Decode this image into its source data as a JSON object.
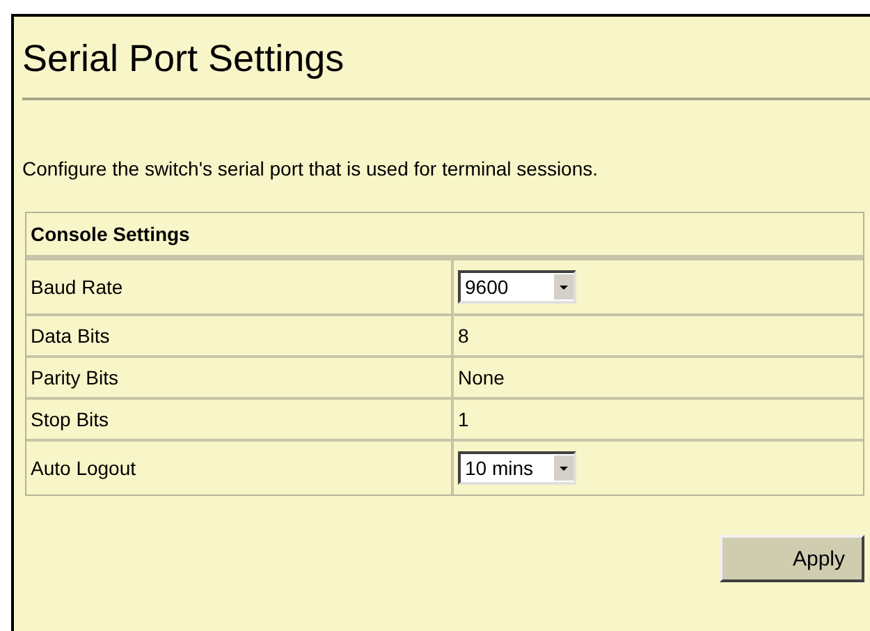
{
  "title": "Serial Port Settings",
  "description": "Configure the switch's serial port that is used for terminal sessions.",
  "table": {
    "heading": "Console Settings",
    "rows": [
      {
        "label": "Baud Rate",
        "kind": "select",
        "value": "9600"
      },
      {
        "label": "Data Bits",
        "kind": "text",
        "value": "8"
      },
      {
        "label": "Parity Bits",
        "kind": "text",
        "value": "None"
      },
      {
        "label": "Stop Bits",
        "kind": "text",
        "value": "1"
      },
      {
        "label": "Auto Logout",
        "kind": "select",
        "value": "10 mins"
      }
    ]
  },
  "buttons": [
    "Apply"
  ]
}
